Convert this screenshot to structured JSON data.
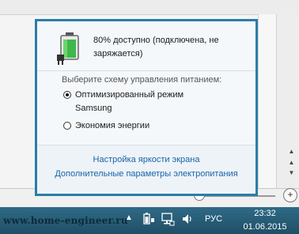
{
  "battery_flyout": {
    "status_line1": "80% доступно (подключена, не",
    "status_line2": "заряжается)",
    "charge_percent": 80,
    "scheme_label": "Выберите схему управления питанием:",
    "schemes": [
      {
        "label_line1": "Оптимизированный режим",
        "label_line2": "Samsung",
        "selected": true
      },
      {
        "label_line1": "Экономия энергии",
        "label_line2": "",
        "selected": false
      }
    ],
    "links": {
      "brightness": "Настройка яркости экрана",
      "advanced": "Дополнительные параметры электропитания"
    }
  },
  "taskbar": {
    "watermark": "www.home-engineer.ru",
    "language": "РУС",
    "time": "23:32",
    "date": "01.06.2015",
    "icons": [
      "tray-overflow-icon",
      "battery-plug-icon",
      "network-icon",
      "speaker-icon"
    ]
  },
  "colors": {
    "flyout_border": "#2a7ea6",
    "link": "#1764a8",
    "taskbar": "#2b5f78",
    "battery_fill": "#3cb94a"
  }
}
